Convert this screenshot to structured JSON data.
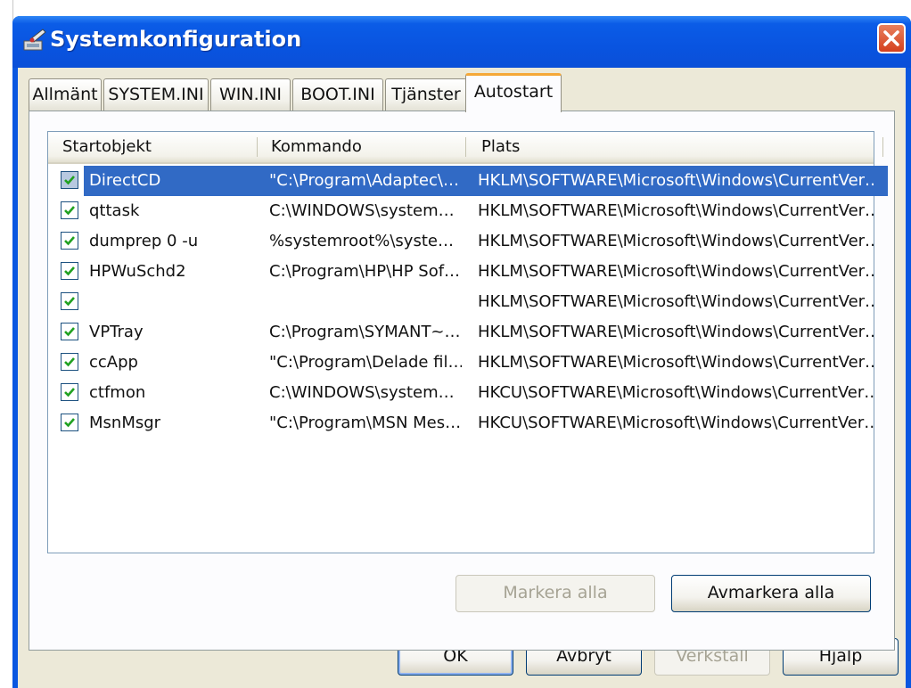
{
  "window": {
    "title": "Systemkonfiguration",
    "close_icon": "close-icon"
  },
  "tabs": [
    {
      "label": "Allmänt",
      "active": false
    },
    {
      "label": "SYSTEM.INI",
      "active": false
    },
    {
      "label": "WIN.INI",
      "active": false
    },
    {
      "label": "BOOT.INI",
      "active": false
    },
    {
      "label": "Tjänster",
      "active": false
    },
    {
      "label": "Autostart",
      "active": true
    }
  ],
  "list": {
    "columns": [
      "Startobjekt",
      "Kommando",
      "Plats"
    ],
    "rows": [
      {
        "checked": true,
        "selected": true,
        "name": "DirectCD",
        "command": "\"C:\\Program\\Adaptec\\…",
        "location": "HKLM\\SOFTWARE\\Microsoft\\Windows\\CurrentVer…"
      },
      {
        "checked": true,
        "selected": false,
        "name": "qttask",
        "command": "C:\\WINDOWS\\system…",
        "location": "HKLM\\SOFTWARE\\Microsoft\\Windows\\CurrentVer…"
      },
      {
        "checked": true,
        "selected": false,
        "name": "dumprep 0 -u",
        "command": "%systemroot%\\syste…",
        "location": "HKLM\\SOFTWARE\\Microsoft\\Windows\\CurrentVer…"
      },
      {
        "checked": true,
        "selected": false,
        "name": "HPWuSchd2",
        "command": "C:\\Program\\HP\\HP Sof…",
        "location": "HKLM\\SOFTWARE\\Microsoft\\Windows\\CurrentVer…"
      },
      {
        "checked": true,
        "selected": false,
        "name": "",
        "command": "",
        "location": "HKLM\\SOFTWARE\\Microsoft\\Windows\\CurrentVer…"
      },
      {
        "checked": true,
        "selected": false,
        "name": "VPTray",
        "command": "C:\\Program\\SYMANT~…",
        "location": "HKLM\\SOFTWARE\\Microsoft\\Windows\\CurrentVer…"
      },
      {
        "checked": true,
        "selected": false,
        "name": "ccApp",
        "command": "\"C:\\Program\\Delade fil…",
        "location": "HKLM\\SOFTWARE\\Microsoft\\Windows\\CurrentVer…"
      },
      {
        "checked": true,
        "selected": false,
        "name": "ctfmon",
        "command": "C:\\WINDOWS\\system…",
        "location": "HKCU\\SOFTWARE\\Microsoft\\Windows\\CurrentVer…"
      },
      {
        "checked": true,
        "selected": false,
        "name": "MsnMsgr",
        "command": "\"C:\\Program\\MSN Mes…",
        "location": "HKCU\\SOFTWARE\\Microsoft\\Windows\\CurrentVer…"
      }
    ]
  },
  "panel_buttons": {
    "select_all": "Markera alla",
    "deselect_all": "Avmarkera alla"
  },
  "dialog_buttons": {
    "ok": "OK",
    "cancel": "Avbryt",
    "apply": "Verkställ",
    "help": "Hjälp"
  },
  "colors": {
    "titlebar": "#0954e0",
    "selection": "#316ac5",
    "tab_accent": "#f5a838",
    "checkmark": "#21a121"
  }
}
